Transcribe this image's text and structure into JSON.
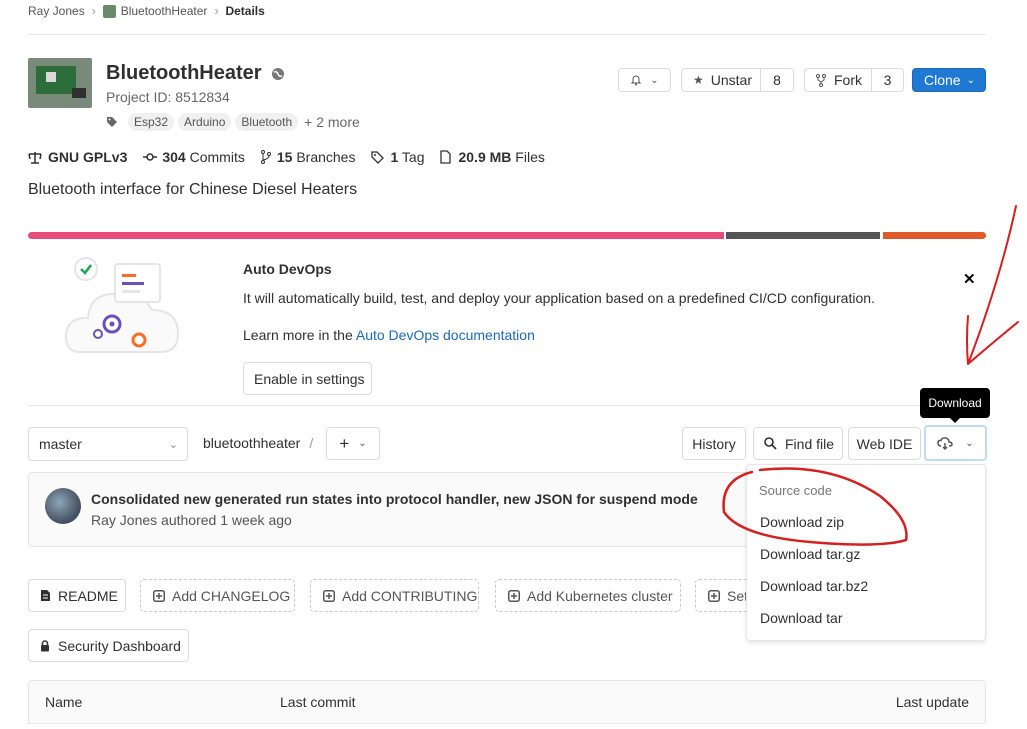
{
  "breadcrumb": {
    "user": "Ray Jones",
    "project": "BluetoothHeater",
    "current": "Details"
  },
  "project": {
    "name": "BluetoothHeater",
    "id_label": "Project ID: 8512834",
    "tags": [
      "Esp32",
      "Arduino",
      "Bluetooth"
    ],
    "more_tags": "+ 2 more",
    "description": "Bluetooth interface for Chinese Diesel Heaters"
  },
  "actions": {
    "unstar": "Unstar",
    "star_count": "8",
    "fork": "Fork",
    "fork_count": "3",
    "clone": "Clone"
  },
  "stats": {
    "license": "GNU GPLv3",
    "commits_num": "304",
    "commits_label": "Commits",
    "branches_num": "15",
    "branches_label": "Branches",
    "tags_num": "1",
    "tags_label": "Tag",
    "files_size": "20.9 MB",
    "files_label": "Files"
  },
  "languages_bar": {
    "colors": [
      "#e84d7a",
      "#555555",
      "#e05a2b"
    ]
  },
  "auto_devops": {
    "title": "Auto DevOps",
    "body": "It will automatically build, test, and deploy your application based on a predefined CI/CD configuration.",
    "learn_prefix": "Learn more in the",
    "learn_link": "Auto DevOps documentation",
    "enable_button": "Enable in settings"
  },
  "repo_nav": {
    "branch": "master",
    "path": "bluetoothheater",
    "separator": "/",
    "add": "+",
    "history": "History",
    "find_file": "Find file",
    "web_ide": "Web IDE",
    "download_tooltip": "Download"
  },
  "download_menu": {
    "header": "Source code",
    "items": [
      "Download zip",
      "Download tar.gz",
      "Download tar.bz2",
      "Download tar"
    ]
  },
  "last_commit": {
    "message": "Consolidated new generated run states into protocol handler, new JSON for suspend mode",
    "author_line": "Ray Jones authored 1 week ago"
  },
  "quick_buttons": {
    "readme": "README",
    "changelog": "Add CHANGELOG",
    "contributing": "Add CONTRIBUTING",
    "kubernetes": "Add Kubernetes cluster",
    "setup_partial": "Set",
    "security": "Security Dashboard"
  },
  "file_table": {
    "col_name": "Name",
    "col_last_commit": "Last commit",
    "col_last_update": "Last update"
  }
}
